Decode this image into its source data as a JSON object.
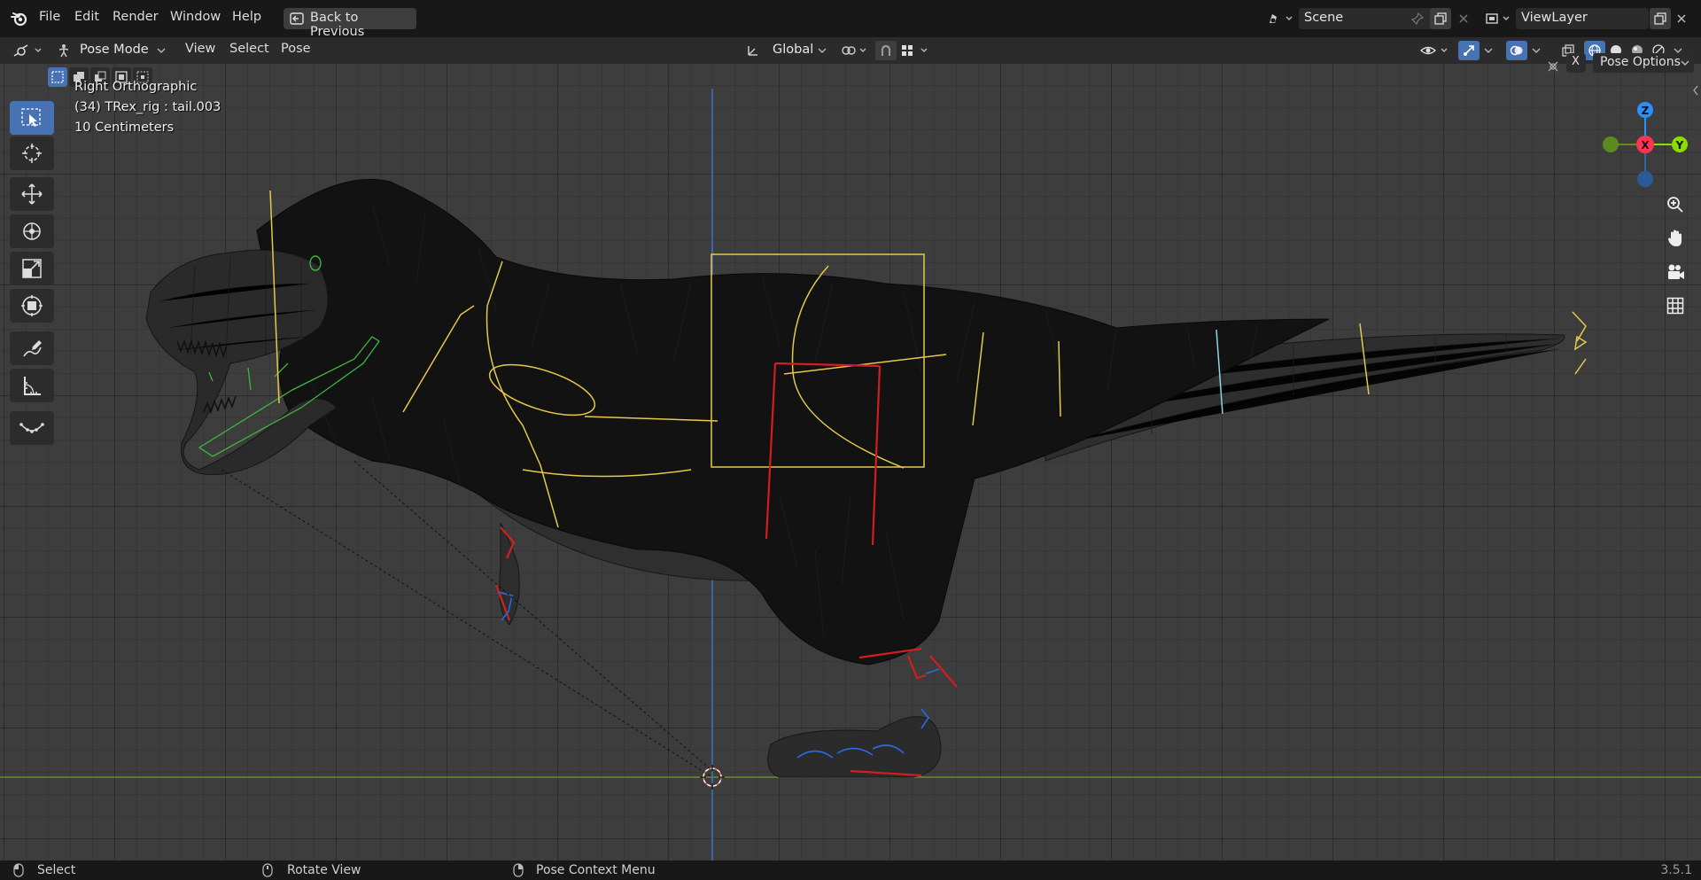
{
  "menu": {
    "file": "File",
    "edit": "Edit",
    "render": "Render",
    "window": "Window",
    "help": "Help",
    "back_button": "Back to Previous"
  },
  "scene": {
    "name": "Scene",
    "view_layer": "ViewLayer"
  },
  "header": {
    "mode": "Pose Mode",
    "view": "View",
    "select": "Select",
    "pose": "Pose",
    "transform_orientation": "Global",
    "pose_options": "Pose Options",
    "x_label": "X"
  },
  "overlay": {
    "view_name": "Right Orthographic",
    "object_info": "(34) TRex_rig : tail.003",
    "scale": "10 Centimeters"
  },
  "gizmo": {
    "z": "Z",
    "x": "X",
    "y": "Y"
  },
  "status": {
    "select": "Select",
    "rotate": "Rotate View",
    "context": "Pose Context Menu",
    "version": "3.5.1"
  },
  "colors": {
    "accent": "#4772b3",
    "bone_yellow": "#e6c84a",
    "bone_red": "#d21e1e",
    "bone_green": "#3fb53f",
    "axis_x": "#ff3352",
    "axis_y": "#8bdc00",
    "axis_z": "#2890ff"
  }
}
